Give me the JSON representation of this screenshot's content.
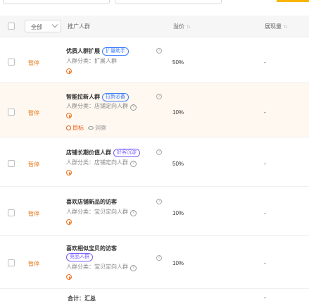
{
  "header": {
    "filter_value": "全部",
    "col_name": "推广人群",
    "col_premium": "溢价",
    "col_display": "展现量",
    "sort_glyph": "↑↓"
  },
  "rows": [
    {
      "status": "暂停",
      "name": "优质人群扩展",
      "tag": "扩量助手",
      "category": "人群分类：扩展人群",
      "premium": "50%",
      "display": "-"
    },
    {
      "status": "暂停",
      "name": "智能拉新人群",
      "tag": "拉新必备",
      "category": "人群分类：店铺定向人群",
      "premium": "10%",
      "display": "-",
      "target_label": "目标",
      "observe_label": "洞察"
    },
    {
      "status": "暂停",
      "name": "店铺长期价值人群",
      "tag": "好客沉淀",
      "category": "人群分类：店铺定向人群",
      "premium": "50%",
      "display": "-"
    },
    {
      "status": "暂停",
      "name": "喜欢店铺新品的访客",
      "category": "人群分类：宝贝定向人群",
      "premium": "10%",
      "display": "-"
    },
    {
      "status": "暂停",
      "name": "喜欢相似宝贝的访客",
      "tag": "竞品人群",
      "category": "人群分类：宝贝定向人群",
      "premium": "10%",
      "display": "-"
    }
  ],
  "total": {
    "label": "合计：汇总",
    "display": "-"
  },
  "colors": {
    "status": "#e67e22",
    "tag": "#3b7cff",
    "tag_alt": "#7a5cff",
    "accent": "#f7b500"
  }
}
